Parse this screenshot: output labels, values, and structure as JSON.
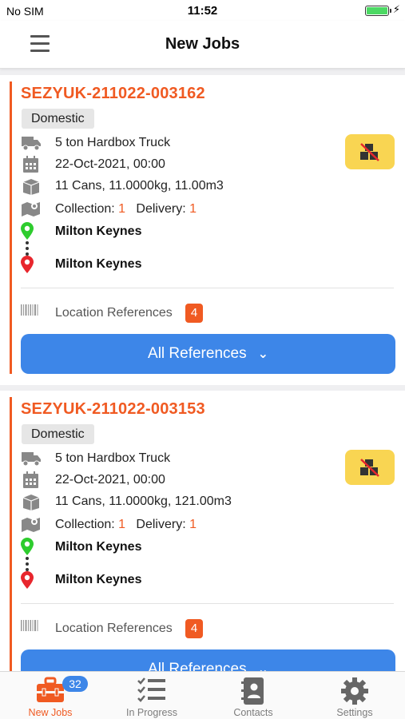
{
  "status_bar": {
    "carrier": "No SIM",
    "time": "11:52",
    "charging_symbol": "⚡"
  },
  "header": {
    "title": "New Jobs",
    "menu_icon": "hamburger-icon"
  },
  "colors": {
    "accent": "#f05a22",
    "primary_button": "#3d86e8",
    "warning_button": "#f9d552",
    "pin_start": "#2ecc2e",
    "pin_end": "#e8262d"
  },
  "jobs": [
    {
      "id": "SEZYUK-211022-003162",
      "type": "Domestic",
      "vehicle": "5 ton Hardbox Truck",
      "datetime": "22-Oct-2021, 00:00",
      "load": "11 Cans, 11.0000kg, 11.00m3",
      "collection_label": "Collection:",
      "collection_count": "1",
      "delivery_label": "Delivery:",
      "delivery_count": "1",
      "from": "Milton Keynes",
      "to": "Milton Keynes",
      "location_references_label": "Location References",
      "location_references_count": "4",
      "all_references_label": "All References"
    },
    {
      "id": "SEZYUK-211022-003153",
      "type": "Domestic",
      "vehicle": "5 ton Hardbox Truck",
      "datetime": "22-Oct-2021, 00:00",
      "load": "11 Cans, 11.0000kg, 121.00m3",
      "collection_label": "Collection:",
      "collection_count": "1",
      "delivery_label": "Delivery:",
      "delivery_count": "1",
      "from": "Milton Keynes",
      "to": "Milton Keynes",
      "location_references_label": "Location References",
      "location_references_count": "4",
      "all_references_label": "All References"
    }
  ],
  "tabs": [
    {
      "label": "New Jobs",
      "icon": "toolbox-icon",
      "badge": "32",
      "active": true
    },
    {
      "label": "In Progress",
      "icon": "checklist-icon",
      "active": false
    },
    {
      "label": "Contacts",
      "icon": "contacts-book-icon",
      "active": false
    },
    {
      "label": "Settings",
      "icon": "gear-icon",
      "active": false
    }
  ]
}
